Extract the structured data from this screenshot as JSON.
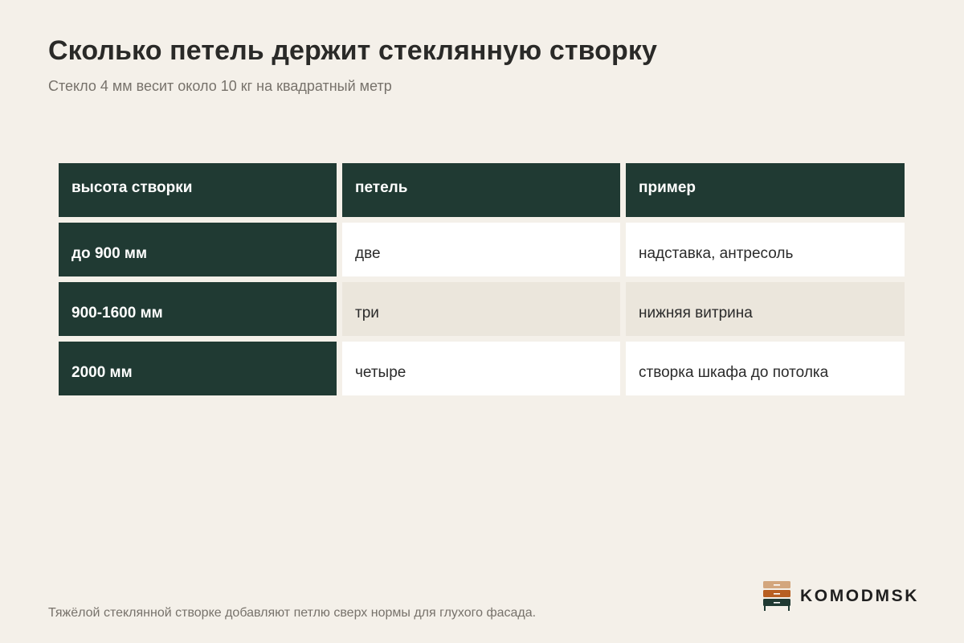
{
  "title": "Сколько петель держит стеклянную створку",
  "subtitle": "Стекло 4 мм весит около 10 кг на квадратный метр",
  "table": {
    "headers": [
      "высота створки",
      "петель",
      "пример"
    ],
    "rows": [
      {
        "height": "до 900 мм",
        "hinges": "две",
        "example": "надставка, антресоль"
      },
      {
        "height": "900-1600 мм",
        "hinges": "три",
        "example": "нижняя витрина"
      },
      {
        "height": "2000 мм",
        "hinges": "четыре",
        "example": "створка шкафа до потолка"
      }
    ]
  },
  "footnote": "Тяжёлой стеклянной створке добавляют петлю сверх нормы для глухого фасада.",
  "brand": {
    "name": "KOMODMSK",
    "icon": "dresser-icon"
  },
  "colors": {
    "background": "#f4f0e9",
    "dark_green": "#203a33",
    "tan": "#d3a67d",
    "orange": "#b85f22",
    "row_white": "#ffffff",
    "row_beige": "#ebe6dc"
  }
}
